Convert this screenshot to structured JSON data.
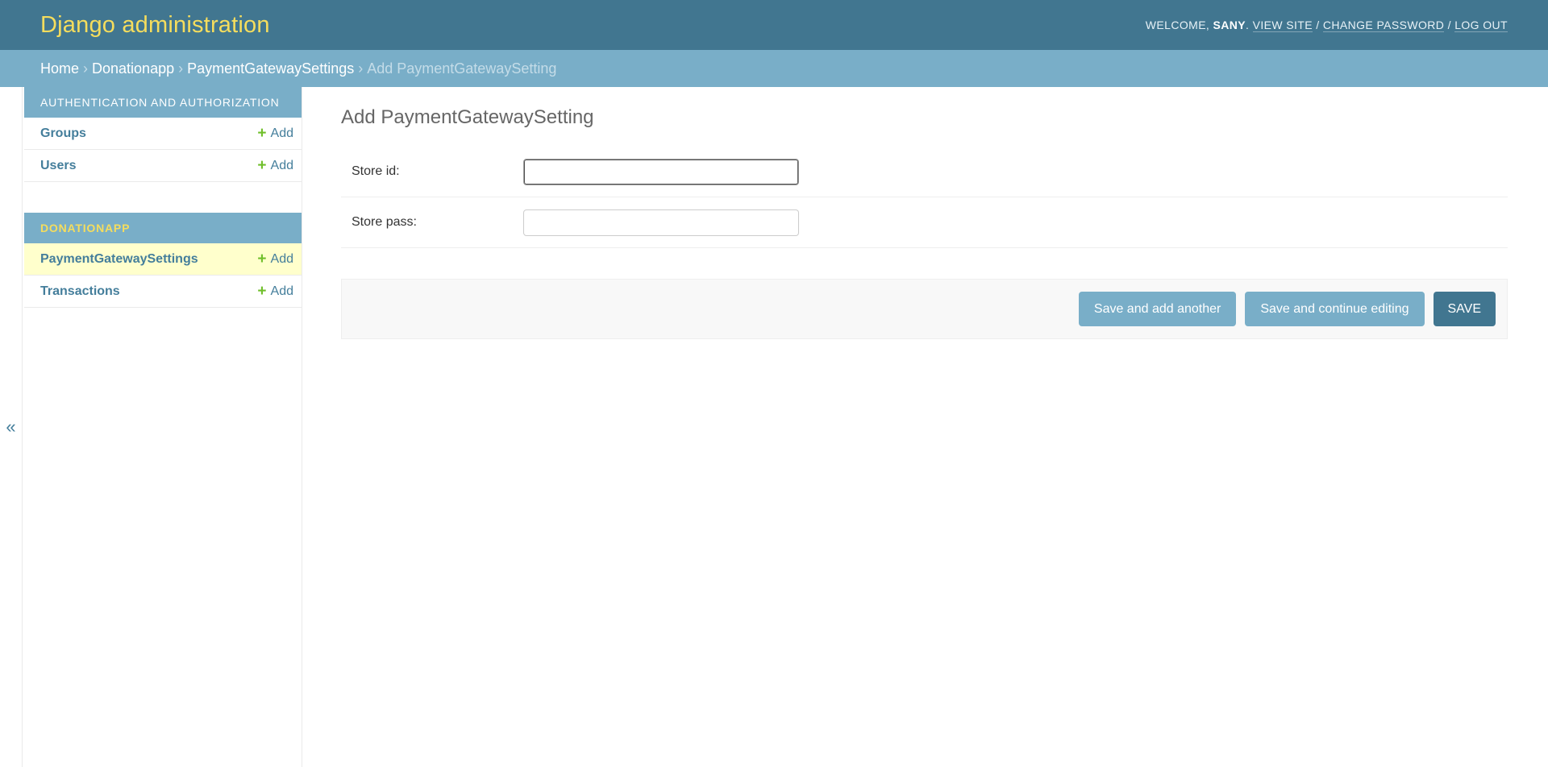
{
  "header": {
    "brand": "Django administration",
    "welcome": "WELCOME, ",
    "username": "SANY",
    "username_suffix": ". ",
    "view_site": "VIEW SITE",
    "change_password": "CHANGE PASSWORD",
    "log_out": "LOG OUT",
    "separator": " / "
  },
  "breadcrumbs": {
    "home": "Home",
    "app": "Donationapp",
    "model": "PaymentGatewaySettings",
    "current": "Add PaymentGatewaySetting",
    "separator": "›"
  },
  "sidebar": {
    "toggle_icon": "«",
    "add_label": "Add",
    "plus_icon": "+",
    "modules": [
      {
        "caption": "Authentication and Authorization",
        "models": [
          "Groups",
          "Users"
        ]
      },
      {
        "caption": "Donationapp",
        "models": [
          "PaymentGatewaySettings",
          "Transactions"
        ]
      }
    ]
  },
  "main": {
    "title": "Add PaymentGatewaySetting",
    "fields": [
      {
        "label": "Store id:",
        "value": ""
      },
      {
        "label": "Store pass:",
        "value": ""
      }
    ],
    "buttons": {
      "save_add_another": "Save and add another",
      "save_continue": "Save and continue editing",
      "save": "SAVE"
    }
  },
  "colors": {
    "header_bg": "#417690",
    "breadcrumb_bg": "#79aec8",
    "brand_yellow": "#f5dd5d",
    "current_row_bg": "#ffffcc",
    "add_plus_green": "#70bf2b"
  }
}
